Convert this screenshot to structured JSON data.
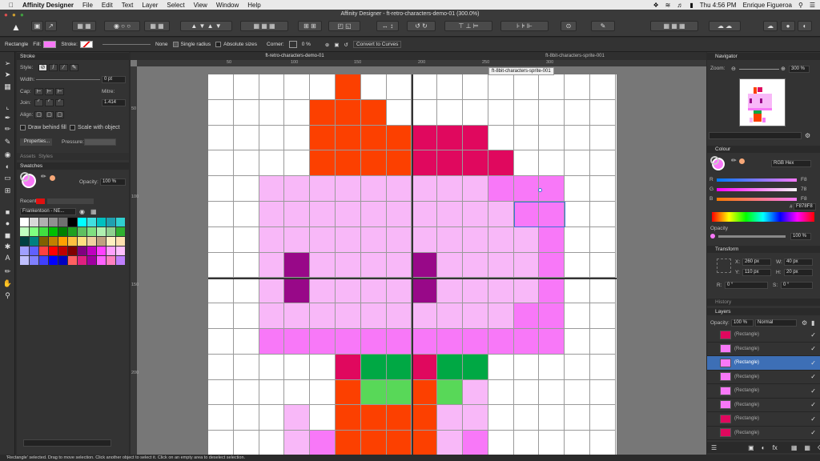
{
  "macmenu": {
    "apple": "",
    "app": "Affinity Designer",
    "items": [
      "File",
      "Edit",
      "Text",
      "Layer",
      "Select",
      "View",
      "Window",
      "Help"
    ],
    "clock": "Thu 4:56 PM",
    "user": "Enrique Figueroa"
  },
  "window": {
    "title": "Affinity Designer - ft-retro-characters-demo-01 (300.0%)"
  },
  "context": {
    "object": "Rectangle",
    "fill": "Fill:",
    "stroke": "Stroke:",
    "stroke_value": "None",
    "single_radius": "Single radius",
    "absolute_sizes": "Absolute sizes",
    "corner": "Corner:",
    "corner_value": "0 %",
    "convert": "Convert to Curves",
    "fill_color": "#f878f8"
  },
  "stroke_panel": {
    "tab": "Stroke",
    "style": "Style:",
    "width": "Width:",
    "width_value": "0 pt",
    "cap": "Cap:",
    "join": "Join:",
    "mitre": "Mitre:",
    "mitre_value": "1.414",
    "align": "Align:",
    "draw_behind": "Draw behind fill",
    "scale_with": "Scale with object",
    "properties": "Properties...",
    "pressure": "Pressure:"
  },
  "assets_tabs": [
    "Assets",
    "Styles"
  ],
  "swatches_panel": {
    "tab": "Swatches",
    "opacity": "Opacity:",
    "opacity_value": "100 %",
    "recent": "Recent:",
    "palette": "Frankentoon - NE...",
    "recent_color": "#e01010",
    "colors": [
      "#ffffff",
      "#d8d8d8",
      "#b0b0b0",
      "#909090",
      "#707070",
      "#000000",
      "#00ffff",
      "#40e0e0",
      "#00c0c0",
      "#20a0b0",
      "#30d0d0",
      "#c0ffc0",
      "#80ff80",
      "#40e040",
      "#00c000",
      "#008000",
      "#20a020",
      "#60c060",
      "#80e080",
      "#b0f0b0",
      "#90d090",
      "#30b030",
      "#004040",
      "#008080",
      "#806000",
      "#c08000",
      "#ffa000",
      "#ffc040",
      "#ffe080",
      "#f0d0a0",
      "#c0a080",
      "#fff0c0",
      "#ffe0b0",
      "#a0a0ff",
      "#6060ff",
      "#ff4040",
      "#ff0000",
      "#c00000",
      "#800000",
      "#800080",
      "#c000c0",
      "#ff40ff",
      "#ffa0ff",
      "#ffc0ff",
      "#c0c0ff",
      "#8080ff",
      "#4040ff",
      "#0000ff",
      "#0000c0",
      "#ff6060",
      "#e02080",
      "#a000a0",
      "#ff60ff",
      "#ff80c0",
      "#c080ff"
    ]
  },
  "doctabs": [
    "ft-retro-characters-demo-01",
    "ft-8bit-characters-sprite-001"
  ],
  "tooltip": "ft-8bit-characters-sprite-001",
  "ruler_labels": [
    "50",
    "100",
    "150",
    "200",
    "250",
    "300"
  ],
  "vruler_labels": [
    "50",
    "100",
    "150",
    "200"
  ],
  "sprite_colors": {
    "W": "#ffffff",
    "R": "#fc4000",
    "M": "#e0085e",
    "P": "#f8b8f8",
    "H": "#f878f8",
    "V": "#980888",
    "G": "#00a844",
    "L": "#58d858"
  },
  "sprite_rows": [
    "WWWWWRWWWWWWWWWW",
    "WWWWRRRWWWWWWWWW",
    "WWWWRRRRMMMWWWWW",
    "WWWWRRRRMMMMWWWW",
    "WWPPPPPPPPPHHHWW",
    "WWPPPPPPPPPPHHWW",
    "WWPPPPPPPPPPPHWW",
    "WWPVPPPPVPPPPHWW",
    "WWPVPPPPVPPPPHWW",
    "WWPPPPPPPPPPHHWW",
    "WWHHHHHHHHHHHHWW",
    "WWWWWMGGMGGWWWWW",
    "WWWWWRLLRLPWWWWW",
    "WWWPWRRRRPPWWWWW",
    "WWWPHRRRRPHWWWWW"
  ],
  "navigator": {
    "tab": "Navigator",
    "zoom_label": "Zoom:",
    "zoom_value": "300 %"
  },
  "colour": {
    "tab": "Colour",
    "mode": "RGB Hex",
    "r": "F8",
    "g": "78",
    "b": "F8",
    "hex": "F878F8",
    "opacity": "Opacity",
    "opacity_value": "100 %"
  },
  "transform": {
    "tab": "Transform",
    "x": "260 px",
    "y": "110 px",
    "w": "40 px",
    "h": "20 px",
    "r": "0 °",
    "s": "0 °"
  },
  "history": {
    "tab": "History"
  },
  "layers": {
    "tab": "Layers",
    "opacity": "Opacity:",
    "opacity_value": "100 %",
    "blend": "Normal",
    "items": [
      {
        "name": "(Rectangle)",
        "color": "#e0085e",
        "selected": false
      },
      {
        "name": "(Rectangle)",
        "color": "#f878f8",
        "selected": false
      },
      {
        "name": "(Rectangle)",
        "color": "#f878f8",
        "selected": true
      },
      {
        "name": "(Rectangle)",
        "color": "#f878f8",
        "selected": false
      },
      {
        "name": "(Rectangle)",
        "color": "#f878f8",
        "selected": false
      },
      {
        "name": "(Rectangle)",
        "color": "#f878f8",
        "selected": false
      },
      {
        "name": "(Rectangle)",
        "color": "#e0085e",
        "selected": false
      },
      {
        "name": "(Rectangle)",
        "color": "#e0085e",
        "selected": false
      }
    ]
  },
  "status": "'Rectangle' selected. Drag to move selection. Click another object to select it. Click on an empty area to deselect selection."
}
